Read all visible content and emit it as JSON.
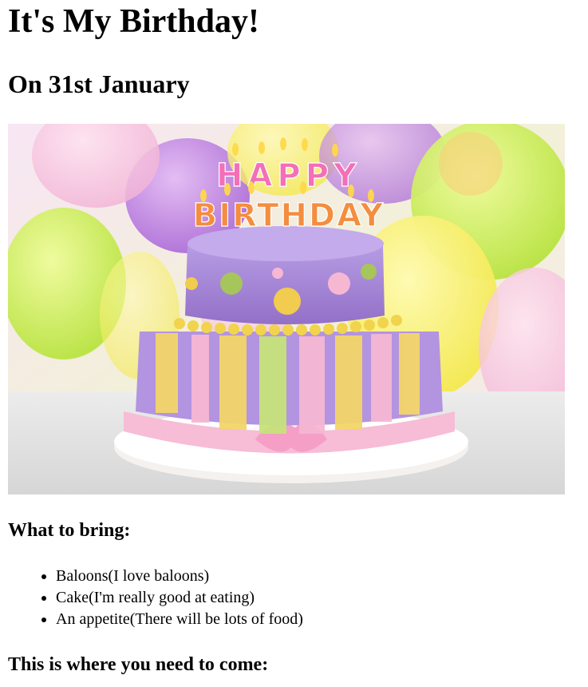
{
  "page": {
    "title": "It's My Birthday!",
    "subtitle": "On 31st January"
  },
  "photo": {
    "alt": "Birthday cake with HAPPY BIRTHDAY candles",
    "candle_text_top": "HAPPY",
    "candle_text_bottom": "BIRTHDAY"
  },
  "bring": {
    "heading": "What to bring:",
    "items": [
      "Baloons(I love baloons)",
      "Cake(I'm really good at eating)",
      "An appetite(There will be lots of food)"
    ]
  },
  "location": {
    "heading": "This is where you need to come:"
  }
}
